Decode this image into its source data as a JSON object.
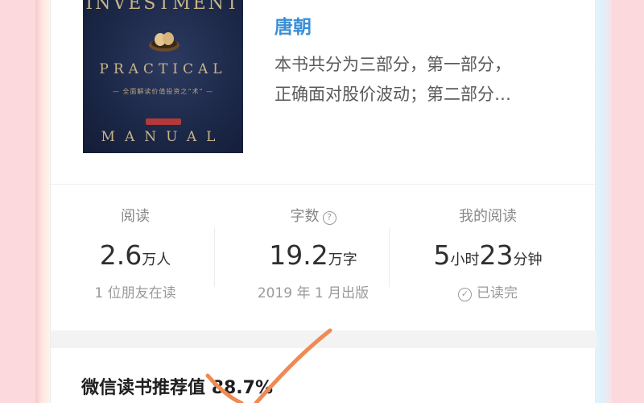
{
  "book": {
    "cover": {
      "title_top": "INVESTMENT",
      "title_mid": "PRACTICAL",
      "subtitle": "— 全面解读价值投资之“术” —",
      "title_bottom": "MANUAL"
    },
    "author": "唐朝",
    "description_line1": "本书共分为三部分，第一部分，",
    "description_line2": "正确面对股价波动；第二部分…"
  },
  "stats": {
    "reads": {
      "label": "阅读",
      "value": "2.6",
      "unit": "万人",
      "sub": "1 位朋友在读"
    },
    "words": {
      "label": "字数",
      "value": "19.2",
      "unit": "万字",
      "sub": "2019 年 1 月出版",
      "help_icon": "?"
    },
    "my_reading": {
      "label": "我的阅读",
      "hours": "5",
      "hours_unit": "小时",
      "minutes": "23",
      "minutes_unit": "分钟",
      "sub": "已读完",
      "check_icon": "✓"
    }
  },
  "recommend": {
    "label": "微信读书推荐值",
    "value": "88.7%"
  },
  "colors": {
    "author": "#3a8fd6",
    "scribble": "#ee8a55",
    "background": "#fbd9dd"
  }
}
